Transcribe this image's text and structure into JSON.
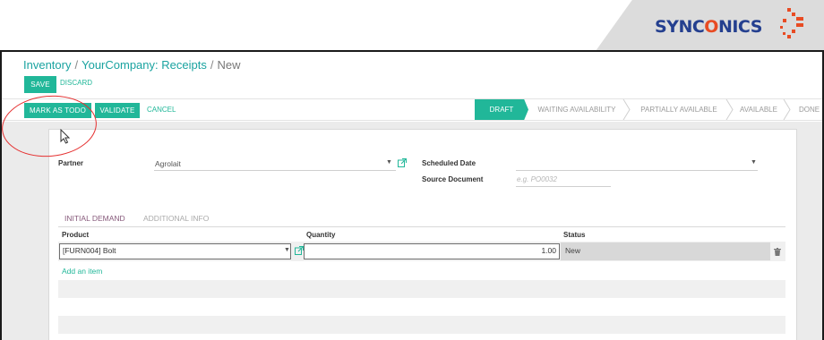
{
  "branding": {
    "logo_text": "SYNCONICS",
    "logo_o": "O",
    "logo_colors": {
      "text": "#243f8f",
      "accent": "#e84b23"
    }
  },
  "breadcrumb": {
    "items": [
      "Inventory",
      "YourCompany: Receipts"
    ],
    "current": "New"
  },
  "toolbar": {
    "save_label": "SAVE",
    "discard_label": "DISCARD"
  },
  "actions": {
    "mark_todo_label": "MARK AS TODO",
    "validate_label": "VALIDATE",
    "cancel_label": "CANCEL"
  },
  "stages": [
    "DRAFT",
    "WAITING AVAILABILITY",
    "PARTIALLY AVAILABLE",
    "AVAILABLE",
    "DONE"
  ],
  "active_stage": "DRAFT",
  "form": {
    "partner_label": "Partner",
    "partner_value": "Agrolait",
    "scheduled_date_label": "Scheduled Date",
    "scheduled_date_value": "",
    "source_document_label": "Source Document",
    "source_document_placeholder": "e.g. PO0032"
  },
  "tabs": [
    {
      "label": "INITIAL DEMAND",
      "active": true
    },
    {
      "label": "ADDITIONAL INFO",
      "active": false
    }
  ],
  "table": {
    "columns": [
      "Product",
      "Quantity",
      "Status"
    ],
    "rows": [
      {
        "product": "[FURN004] Bolt",
        "quantity": "1.00",
        "status": "New"
      }
    ],
    "add_item_label": "Add an item"
  },
  "colors": {
    "primary": "#21b799",
    "tab_active": "#875a7b",
    "annotation": "#e53030"
  },
  "icons": [
    "external-link-icon",
    "dropdown-caret-icon",
    "trash-icon",
    "cursor-icon"
  ]
}
